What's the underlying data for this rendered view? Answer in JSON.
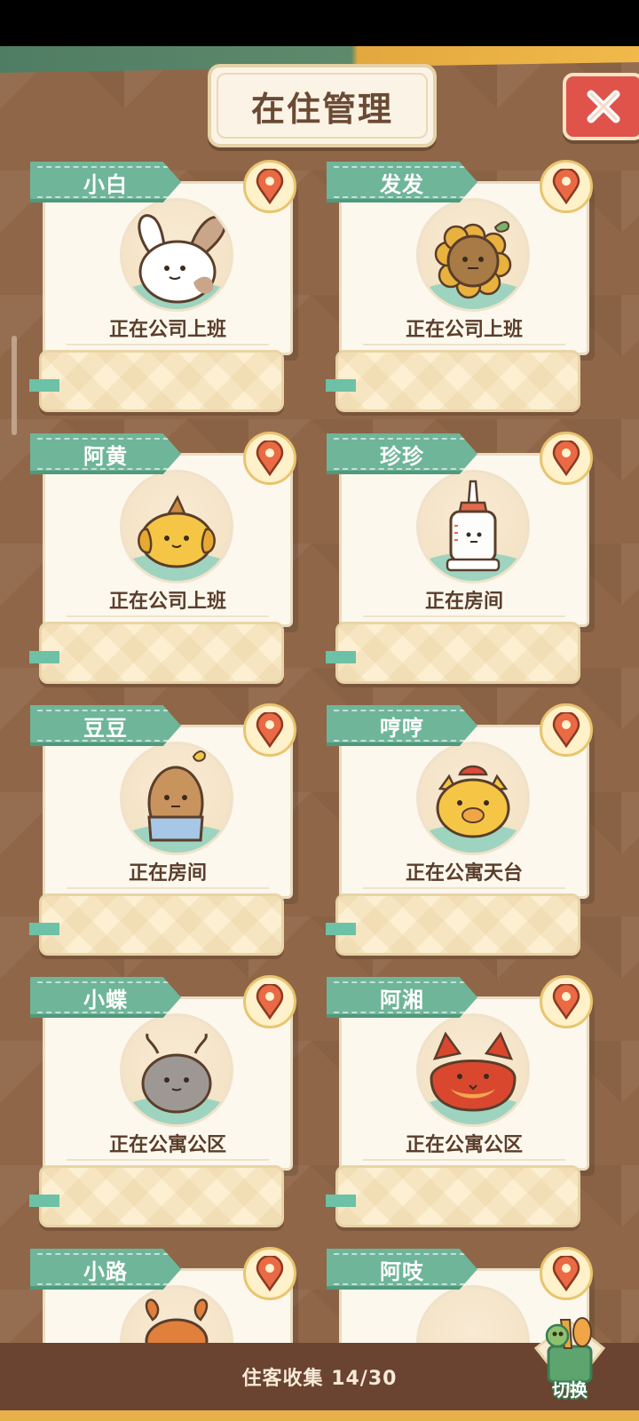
{
  "header": {
    "title": "在住管理",
    "close_icon": "close-x-icon"
  },
  "residents": [
    {
      "name": "小白",
      "status": "正在公司上班",
      "character": "bunny"
    },
    {
      "name": "发发",
      "status": "正在公司上班",
      "character": "sunflower"
    },
    {
      "name": "阿黄",
      "status": "正在公司上班",
      "character": "dog"
    },
    {
      "name": "珍珍",
      "status": "正在房间",
      "character": "glue-bottle"
    },
    {
      "name": "豆豆",
      "status": "正在房间",
      "character": "potato"
    },
    {
      "name": "哼哼",
      "status": "正在公寓天台",
      "character": "pig"
    },
    {
      "name": "小蝶",
      "status": "正在公寓公区",
      "character": "snail"
    },
    {
      "name": "阿湘",
      "status": "正在公寓公区",
      "character": "fox"
    },
    {
      "name": "小路",
      "status": "",
      "character": "crab"
    },
    {
      "name": "阿吱",
      "status": "",
      "character": "unknown"
    }
  ],
  "footer": {
    "collect_label": "住客收集 14/30",
    "switch_label": "切换"
  },
  "colors": {
    "background": "#8f6648",
    "banner": "#6fb59a",
    "card": "#fdf8ee",
    "close": "#e0534b",
    "bottom_bar": "#6b4331"
  }
}
